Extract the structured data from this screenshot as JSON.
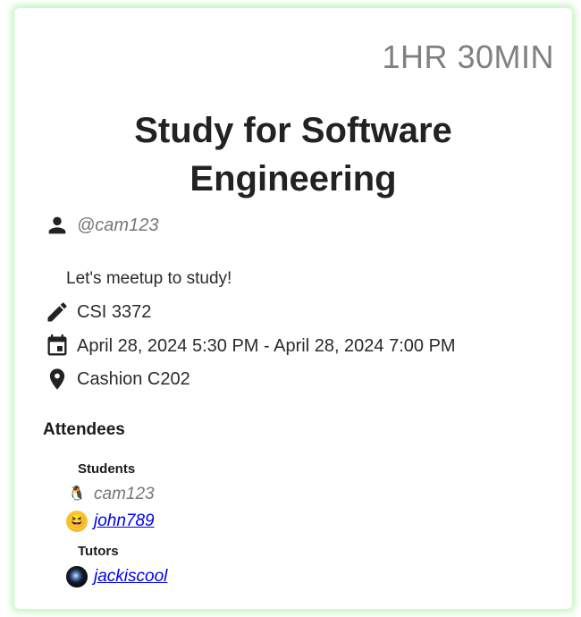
{
  "event": {
    "duration": "1HR 30MIN",
    "title": "Study for Software Engineering",
    "host": "@cam123",
    "description": "Let's meetup to study!",
    "course": "CSI 3372",
    "dates": "April 28, 2024 5:30 PM - April 28, 2024 7:00 PM",
    "location": "Cashion C202"
  },
  "attendees": {
    "heading": "Attendees",
    "students_heading": "Students",
    "tutors_heading": "Tutors",
    "students": [
      {
        "name": "cam123",
        "avatar": "penguin-icon",
        "link": false
      },
      {
        "name": "john789",
        "avatar": "laughing-emoji-avatar",
        "link": true
      }
    ],
    "tutors": [
      {
        "name": "jackiscool",
        "avatar": "photo-avatar",
        "link": true
      }
    ]
  },
  "colors": {
    "card_glow": "#c9f7c4",
    "link": "#0000ee",
    "muted": "#777777",
    "duration": "#808080"
  }
}
